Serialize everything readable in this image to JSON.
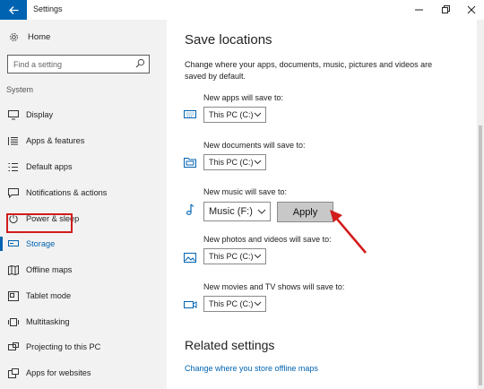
{
  "window": {
    "title": "Settings"
  },
  "sidebar": {
    "home_label": "Home",
    "search_placeholder": "Find a setting",
    "section_label": "System",
    "items": [
      {
        "label": "Display",
        "icon": "monitor-icon"
      },
      {
        "label": "Apps & features",
        "icon": "list-icon"
      },
      {
        "label": "Default apps",
        "icon": "default-apps-icon"
      },
      {
        "label": "Notifications & actions",
        "icon": "notification-icon"
      },
      {
        "label": "Power & sleep",
        "icon": "power-icon"
      },
      {
        "label": "Storage",
        "icon": "storage-icon",
        "active": true
      },
      {
        "label": "Offline maps",
        "icon": "map-icon"
      },
      {
        "label": "Tablet mode",
        "icon": "tablet-icon"
      },
      {
        "label": "Multitasking",
        "icon": "multitasking-icon"
      },
      {
        "label": "Projecting to this PC",
        "icon": "projector-icon"
      },
      {
        "label": "Apps for websites",
        "icon": "web-apps-icon"
      }
    ]
  },
  "main": {
    "title": "Save locations",
    "description": "Change where your apps, documents, music, pictures and videos are saved by default.",
    "groups": [
      {
        "label": "New apps will save to:",
        "value": "This PC (C:)",
        "icon": "keyboard-icon"
      },
      {
        "label": "New documents will save to:",
        "value": "This PC (C:)",
        "icon": "folder-icon"
      },
      {
        "label": "New music will save to:",
        "value": "Music (F:)",
        "icon": "music-note-icon",
        "apply_label": "Apply"
      },
      {
        "label": "New photos and videos will save to:",
        "value": "This PC (C:)",
        "icon": "photo-icon"
      },
      {
        "label": "New movies and TV shows will save to:",
        "value": "This PC (C:)",
        "icon": "video-camera-icon"
      }
    ],
    "related_title": "Related settings",
    "related_link": "Change where you store offline maps"
  },
  "colors": {
    "accent": "#0063b1",
    "highlight": "#d11c1c"
  }
}
